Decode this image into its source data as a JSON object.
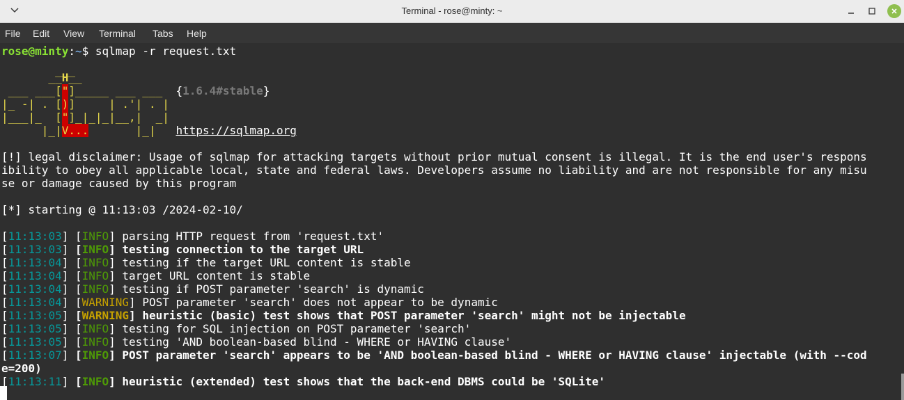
{
  "window": {
    "title": "Terminal - rose@minty: ~",
    "accent": "#8fbf4f"
  },
  "menu": [
    "File",
    "Edit",
    "View",
    "Terminal",
    "Tabs",
    "Help"
  ],
  "prompt": {
    "user_host": "rose@minty",
    "sep": ":",
    "path": "~",
    "dollar": "$",
    "command": " sqlmap -r request.txt"
  },
  "banner": {
    "l1": "        ___",
    "l2a": "       __",
    "l2b": "H",
    "l2c": "__",
    "l3a": " ___ ___[",
    "l3b": "\"",
    "l3c": "]_____ ___ ___  ",
    "l3d": "{",
    "l3e": "1.6.4#stable",
    "l3f": "}",
    "l4a": "|_ -| . [",
    "l4b": ")",
    "l4c": "]     | .'| . |",
    "l5a": "|___|_  [",
    "l5b": "\"",
    "l5c": "]_|_|_|__,|  _|",
    "l6a": "      |_|",
    "l6b": "V...",
    "l6c": "       |_|   ",
    "l6d": "https://sqlmap.org"
  },
  "disclaimer": [
    "[!] legal disclaimer: Usage of sqlmap for attacking targets without prior mutual consent is illegal. It is the end user's respons",
    "ibility to obey all applicable local, state and federal laws. Developers assume no liability and are not responsible for any misu",
    "se or damage caused by this program"
  ],
  "starting": "[*] starting @ 11:13:03 /2024-02-10/",
  "log": [
    {
      "time": "11:13:03",
      "level": "INFO",
      "msg": "parsing HTTP request from 'request.txt'"
    },
    {
      "time": "11:13:03",
      "level": "INFO",
      "msg": "testing connection to the target URL"
    },
    {
      "time": "11:13:04",
      "level": "INFO",
      "msg": "testing if the target URL content is stable"
    },
    {
      "time": "11:13:04",
      "level": "INFO",
      "msg": "target URL content is stable"
    },
    {
      "time": "11:13:04",
      "level": "INFO",
      "msg": "testing if POST parameter 'search' is dynamic"
    },
    {
      "time": "11:13:04",
      "level": "WARNING",
      "msg": "POST parameter 'search' does not appear to be dynamic"
    },
    {
      "time": "11:13:05",
      "level": "WARNING",
      "msg": "heuristic (basic) test shows that POST parameter 'search' might not be injectable"
    },
    {
      "time": "11:13:05",
      "level": "INFO",
      "msg": "testing for SQL injection on POST parameter 'search'"
    },
    {
      "time": "11:13:05",
      "level": "INFO",
      "msg": "testing 'AND boolean-based blind - WHERE or HAVING clause'"
    },
    {
      "time": "11:13:07",
      "level": "INFO",
      "msg": "POST parameter 'search' appears to be 'AND boolean-based blind - WHERE or HAVING clause' injectable (with --cod"
    },
    {
      "time": "11:13:11",
      "level": "INFO",
      "msg": "heuristic (extended) test shows that the back-end DBMS could be 'SQLite'"
    }
  ],
  "wrap_line": "e=200)",
  "icons": {
    "window_menu": "chevron-down-icon",
    "minimize": "minimize-icon",
    "maximize": "maximize-icon",
    "close": "close-icon"
  }
}
